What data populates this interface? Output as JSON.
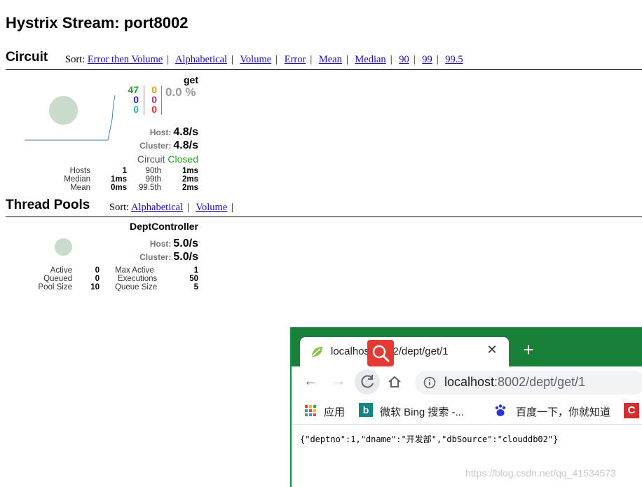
{
  "page_title": "Hystrix Stream: port8002",
  "circuit": {
    "title": "Circuit",
    "sort_label": "Sort:",
    "sort_links": [
      "Error then Volume",
      "Alphabetical",
      "Volume",
      "Error",
      "Mean",
      "Median",
      "90",
      "99",
      "99.5"
    ],
    "card": {
      "name": "get",
      "success": "47",
      "short_circuited": "0",
      "bad_request": "0",
      "timeout": "0",
      "rejected": "0",
      "failure": "0",
      "error_pct": "0.0 %",
      "host_label": "Host:",
      "host_rate": "4.8/s",
      "cluster_label": "Cluster:",
      "cluster_rate": "4.8/s",
      "circuit_label": "Circuit",
      "circuit_status": "Closed",
      "stats": [
        {
          "k1": "Hosts",
          "v1": "1",
          "k2": "90th",
          "v2": "1ms"
        },
        {
          "k1": "Median",
          "v1": "1ms",
          "k2": "99th",
          "v2": "2ms"
        },
        {
          "k1": "Mean",
          "v1": "0ms",
          "k2": "99.5th",
          "v2": "2ms"
        }
      ]
    }
  },
  "thread_pools": {
    "title": "Thread Pools",
    "sort_label": "Sort:",
    "sort_links": [
      "Alphabetical",
      "Volume"
    ],
    "card": {
      "name": "DeptController",
      "host_label": "Host:",
      "host_rate": "5.0/s",
      "cluster_label": "Cluster:",
      "cluster_rate": "5.0/s",
      "stats": [
        {
          "k1": "Active",
          "v1": "0",
          "k2": "Max Active",
          "v2": "1"
        },
        {
          "k1": "Queued",
          "v1": "0",
          "k2": "Executions",
          "v2": "50"
        },
        {
          "k1": "Pool Size",
          "v1": "10",
          "k2": "Queue Size",
          "v2": "5"
        }
      ]
    }
  },
  "browser": {
    "tab_title": "localhost:8002/dept/get/1",
    "url_host": "localhost",
    "url_rest": ":8002/dept/get/1",
    "bookmarks": [
      "应用",
      "微软 Bing 搜索 -...",
      "百度一下，你就知道"
    ],
    "body_text": "{\"deptno\":1,\"dname\":\"开发部\",\"dbSource\":\"clouddb02\"}"
  },
  "watermark": "https://blog.csdn.net/qq_41534573",
  "colors": {
    "success": "#2ca02c",
    "short_circuited": "#1f1fd6",
    "bad_request": "#26b5a0",
    "timeout": "#f0a30a",
    "rejected": "#9b2d9b",
    "failure": "#e3262a",
    "closed": "#2ca02c",
    "chrome_green": "#188038"
  }
}
